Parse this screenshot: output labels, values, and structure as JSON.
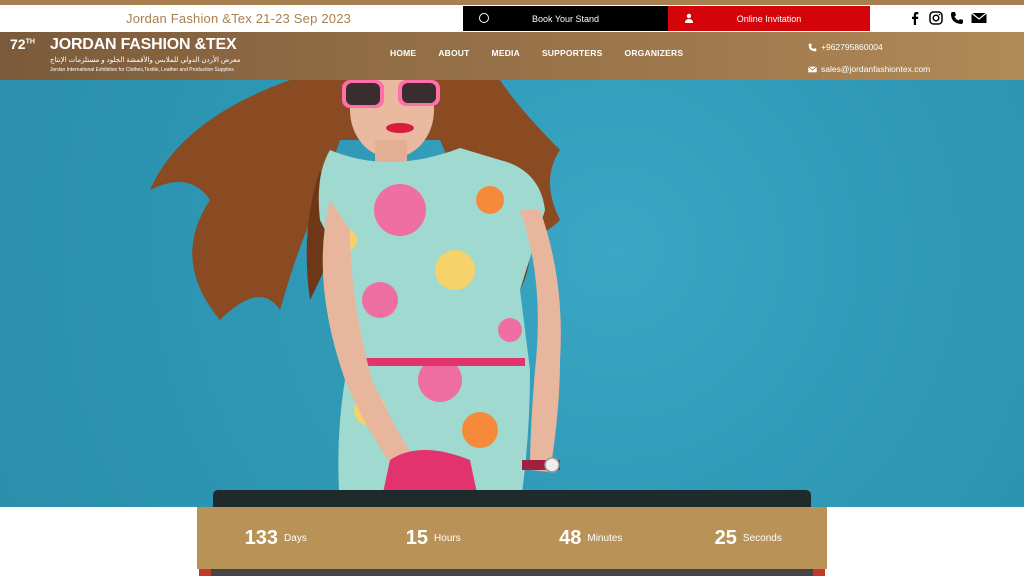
{
  "topbar": {
    "event_title": "Jordan Fashion &Tex 21-23 Sep 2023",
    "book_stand_label": "Book Your Stand",
    "online_invitation_label": "Online Invitation",
    "social_icons": [
      "facebook-icon",
      "instagram-icon",
      "phone-icon",
      "email-icon"
    ]
  },
  "logo": {
    "edition": "72",
    "edition_suffix": "TH",
    "brand": "JORDAN FASHION &TEX",
    "arabic_tagline": "معرض الأردن الدولي للملابس والأقمشة الجلود و مستلزمات الإنتاج",
    "english_tagline": "Jordan International Exhibition for Clothes,Textile, Leather and Production Supplies"
  },
  "nav": {
    "items": [
      "HOME",
      "ABOUT",
      "MEDIA",
      "SUPPORTERS",
      "ORGANIZERS"
    ]
  },
  "contact": {
    "phone": "+962795860004",
    "email": "sales@jordanfashiontex.com"
  },
  "countdown": {
    "items": [
      {
        "value": "133",
        "label": "Days"
      },
      {
        "value": "15",
        "label": "Hours"
      },
      {
        "value": "48",
        "label": "Minutes"
      },
      {
        "value": "25",
        "label": "Seconds"
      }
    ]
  },
  "colors": {
    "brand_gold": "#a8804f",
    "countdown_bg": "#b99257",
    "invite_red": "#d3050a",
    "hero_bg": "#2e98b5"
  }
}
